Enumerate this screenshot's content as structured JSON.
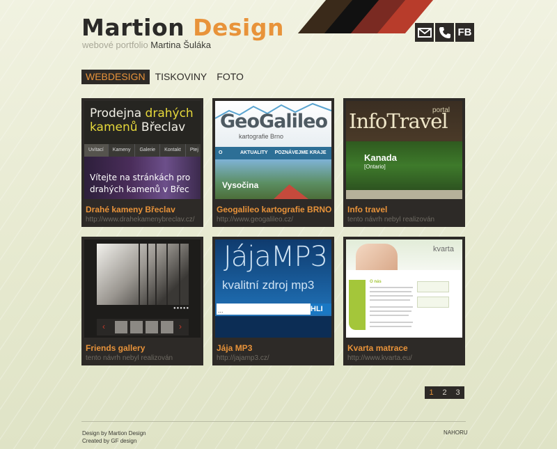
{
  "header": {
    "logo_part1": "Martion",
    "logo_part2": "Design",
    "tagline": "webové portfolio",
    "author": "Martina Šuláka",
    "contact": [
      {
        "label": "",
        "icon": "mail-icon"
      },
      {
        "label": "",
        "icon": "phone-icon"
      },
      {
        "label": "FB",
        "icon": "facebook-icon"
      }
    ]
  },
  "nav": {
    "items": [
      {
        "label": "WEBDESIGN",
        "active": true
      },
      {
        "label": "TISKOVINY",
        "active": false
      },
      {
        "label": "FOTO",
        "active": false
      }
    ]
  },
  "portfolio": [
    {
      "title": "Drahé kameny Břeclav",
      "subtitle": "http://www.drahekamenybreclav.cz/",
      "thumb": {
        "heading_white1": "Prodejna ",
        "heading_yellow1": "drahých",
        "heading_yellow2": "kamenů",
        "heading_white2": " Břeclav",
        "menu": [
          "Uvítací list",
          "Kameny",
          "Galerie",
          "Kontakt",
          "Ptej"
        ],
        "banner_line1": "Vítejte na stránkách pro",
        "banner_line2": "drahých kamenů v Břec"
      }
    },
    {
      "title": "Geogalileo kartografie BRNO",
      "subtitle": "http://www.geogalileo.cz/",
      "thumb": {
        "logo": "GeoGalileo",
        "logo_sub": "kartografie Brno",
        "menu": [
          "O NÁS",
          "AKTUALITY",
          "POZNÁVEJME KRAJE Č"
        ],
        "caption": "Vysočina"
      }
    },
    {
      "title": "Info travel",
      "subtitle": "tento návrh nebyl realizován",
      "thumb": {
        "brand": "InfoTravel",
        "portal": "portal",
        "place": "Kanada",
        "region": "[Ontario]"
      }
    },
    {
      "title": "Friends gallery",
      "subtitle": "tento návrh nebyl realizován",
      "thumb": {
        "dots": "●●●●●"
      }
    },
    {
      "title": "Jája MP3",
      "subtitle": "http://jajamp3.cz/",
      "thumb": {
        "brand": "JájaMP3",
        "slogan": "kvalitní zdroj mp3",
        "search_placeholder": "...",
        "button": "HLI"
      }
    },
    {
      "title": "Kvarta matrace",
      "subtitle": "http://www.kvarta.eu/",
      "thumb": {
        "brand": "kvarta",
        "section": "O nás"
      }
    }
  ],
  "pagination": {
    "pages": [
      "1",
      "2",
      "3"
    ],
    "current": "1"
  },
  "footer": {
    "line1": "Design by Martion Design",
    "line2": "Created by GF design",
    "top_link": "NAHORU"
  },
  "colors": {
    "accent": "#e8933a",
    "dark": "#2d2a27",
    "background": "#e8ebd3"
  }
}
